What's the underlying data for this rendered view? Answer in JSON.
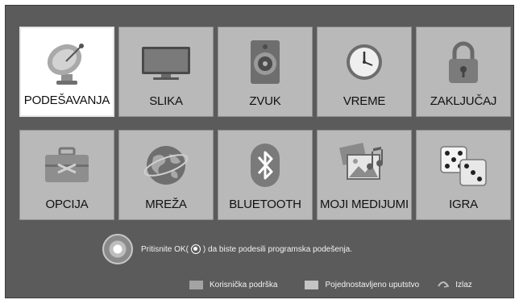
{
  "menu": {
    "items": [
      {
        "label": "PODEŠAVANJA",
        "icon": "satellite-dish-icon",
        "selected": true
      },
      {
        "label": "SLIKA",
        "icon": "tv-screen-icon"
      },
      {
        "label": "ZVUK",
        "icon": "speaker-icon"
      },
      {
        "label": "VREME",
        "icon": "clock-icon"
      },
      {
        "label": "ZAKLJUČAJ",
        "icon": "padlock-icon"
      },
      {
        "label": "OPCIJA",
        "icon": "toolbox-icon"
      },
      {
        "label": "MREŽA",
        "icon": "globe-icon"
      },
      {
        "label": "BLUETOOTH",
        "icon": "bluetooth-icon"
      },
      {
        "label": "MOJI MEDIJUMI",
        "icon": "media-photos-icon"
      },
      {
        "label": "IGRA",
        "icon": "dice-icon"
      }
    ]
  },
  "hint": {
    "before_ok": "Pritisnite OK(",
    "after_ok": ") da biste podesili programska podešenja."
  },
  "footer": {
    "support_label": "Korisnička podrška",
    "guide_label": "Pojednostavljeno uputstvo",
    "exit_label": "Izlaz"
  },
  "colors": {
    "background": "#5b5b5b",
    "tile": "#b9b9b9",
    "tile_selected": "#ffffff"
  }
}
